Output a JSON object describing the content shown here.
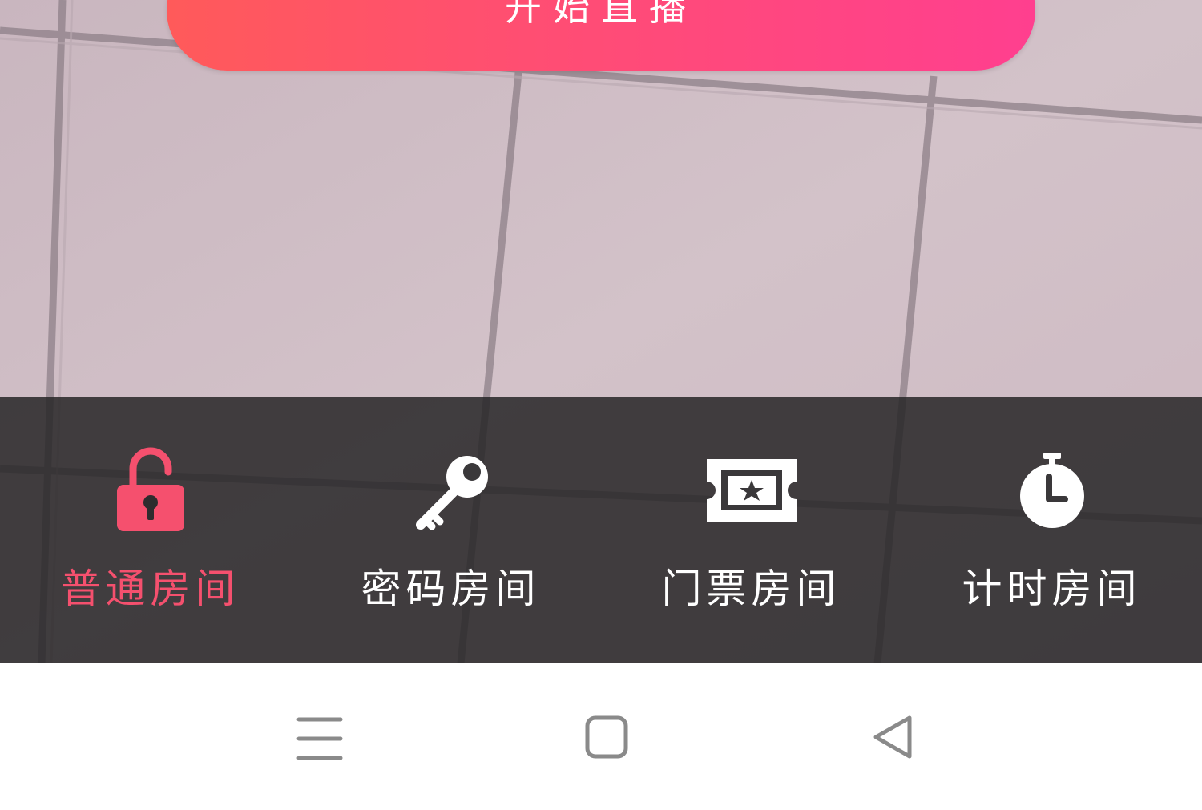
{
  "start_live": {
    "label": "开始直播"
  },
  "room_types": {
    "selected_index": 0,
    "active_color": "#f5506e",
    "items": [
      {
        "label": "普通房间",
        "icon": "unlock-icon",
        "active": true
      },
      {
        "label": "密码房间",
        "icon": "key-icon",
        "active": false
      },
      {
        "label": "门票房间",
        "icon": "ticket-icon",
        "active": false
      },
      {
        "label": "计时房间",
        "icon": "stopwatch-icon",
        "active": false
      }
    ]
  },
  "system_nav": {
    "items": [
      {
        "icon": "menu-icon"
      },
      {
        "icon": "home-square-icon"
      },
      {
        "icon": "back-triangle-icon"
      }
    ]
  }
}
